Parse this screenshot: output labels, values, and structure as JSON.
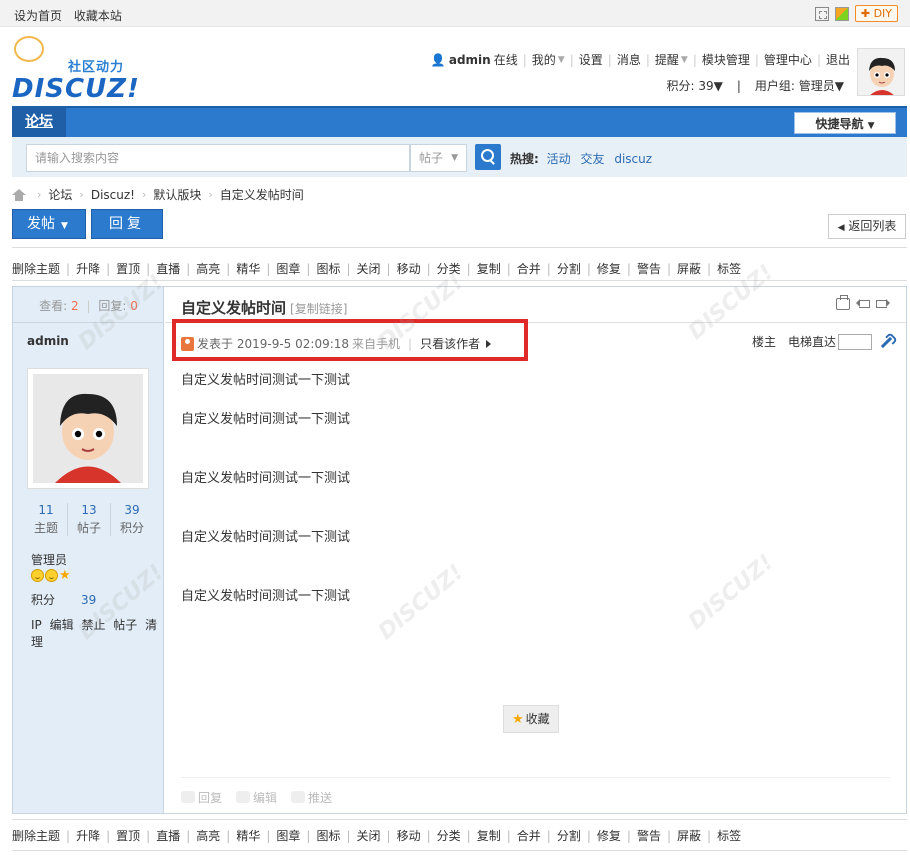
{
  "topbar": {
    "links": [
      "设为首页",
      "收藏本站"
    ],
    "diy_label": "DIY"
  },
  "logo": {
    "slogan": "社区动力",
    "word": "DISCUZ!"
  },
  "usernav": {
    "username": "admin",
    "status": "在线",
    "items": [
      "我的",
      "设置",
      "消息",
      "提醒",
      "模块管理",
      "管理中心",
      "退出"
    ],
    "credits_label": "积分: 39",
    "group_label": "用户组: 管理员"
  },
  "nav": {
    "current": "论坛",
    "quick_nav": "快捷导航"
  },
  "search": {
    "placeholder": "请输入搜索内容",
    "type": "帖子",
    "hot_label": "热搜:",
    "hot_keywords": [
      "活动",
      "交友",
      "discuz"
    ]
  },
  "breadcrumb": [
    "论坛",
    "Discuz!",
    "默认版块",
    "自定义发帖时间"
  ],
  "buttons": {
    "post": "发帖",
    "reply": "回复",
    "back": "返回列表"
  },
  "moderation": [
    "删除主题",
    "升降",
    "置顶",
    "直播",
    "高亮",
    "精华",
    "图章",
    "图标",
    "关闭",
    "移动",
    "分类",
    "复制",
    "合并",
    "分割",
    "修复",
    "警告",
    "屏蔽",
    "标签"
  ],
  "thread": {
    "views_label": "查看:",
    "views": "2",
    "replies_label": "回复:",
    "replies": "0",
    "title": "自定义发帖时间",
    "copy_link": "[复制链接]"
  },
  "author": {
    "name": "admin",
    "topics": "11",
    "topics_label": "主题",
    "posts": "13",
    "posts_label": "帖子",
    "credits": "39",
    "credits_label": "积分",
    "group": "管理员",
    "points_label": "积分",
    "points": "39",
    "admin_links": [
      "IP",
      "编辑",
      "禁止",
      "帖子",
      "清理"
    ]
  },
  "post": {
    "posted_prefix": "发表于",
    "posted_time": "2019-9-5 02:09:18",
    "source": "来自手机",
    "only_author": "只看该作者",
    "floor": "楼主",
    "elevator": "电梯直达",
    "paragraphs": [
      "自定义发帖时间测试一下测试",
      "自定义发帖时间测试一下测试",
      "自定义发帖时间测试一下测试",
      "自定义发帖时间测试一下测试",
      "自定义发帖时间测试一下测试"
    ],
    "favorite": "收藏",
    "footer": [
      "回复",
      "编辑",
      "推送"
    ]
  },
  "colors": {
    "brand_blue": "#2b7acd",
    "highlight_red": "#e02a2a",
    "sidebar_bg": "#e3edf7"
  }
}
